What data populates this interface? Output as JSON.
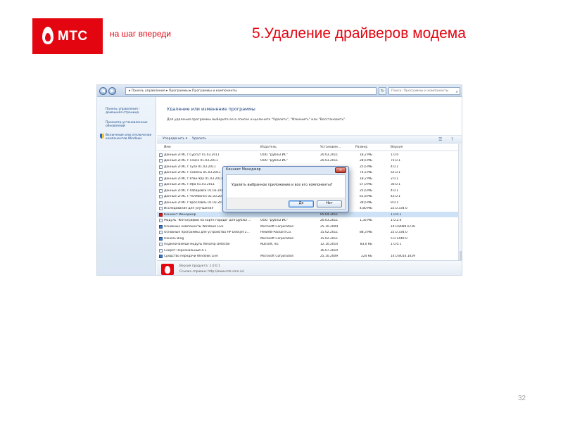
{
  "slide": {
    "logo": "МТС",
    "tagline": "на шаг впереди",
    "title": "5.Удаление драйверов модема",
    "page_number": "32"
  },
  "window": {
    "breadcrumb": "▸ Панель управления ▸ Программы ▸ Программы и компоненты",
    "search_placeholder": "Поиск: Программы и компоненты"
  },
  "sidebar": {
    "items": [
      "Панель управления - домашняя страница",
      "Просмотр установленных обновлений",
      "Включение или отключение компонентов Windows"
    ]
  },
  "main": {
    "heading": "Удаление или изменение программы",
    "subtitle": "Для удаления программы выберите ее в списке и щелкните \"Удалить\", \"Изменить\" или \"Восстановить\"."
  },
  "toolbar": {
    "organize": "Упорядочить ▾",
    "uninstall": "Удалить"
  },
  "columns": [
    "Имя",
    "Издатель",
    "Установле...",
    "Размер",
    "Версия"
  ],
  "rows": [
    {
      "name": "Данные 2ГИС г.Сургут 01.03.2011",
      "publisher": "ООО \"ДубльГИС\"",
      "date": "20.03.2011",
      "size": "18,2 МБ",
      "version": "1.0.0",
      "icon": "gray"
    },
    {
      "name": "Данные 2ГИС г.Томск 01.03.2011",
      "publisher": "ООО \"ДубльГИС\"",
      "date": "20.03.2011",
      "size": "28,6 МБ",
      "version": "75.0.1",
      "icon": "gray"
    },
    {
      "name": "Данные 2ГИС г.Тула 01.03.2011",
      "publisher": "",
      "date": "",
      "size": "25,6 МБ",
      "version": "4.0.1",
      "icon": "gray"
    },
    {
      "name": "Данные 2ГИС г.Тюмень 01.03.2011",
      "publisher": "",
      "date": "",
      "size": "74,5 МБ",
      "version": "52.0.1",
      "icon": "gray"
    },
    {
      "name": "Данные 2ГИС г.Улан-Удэ 01.03.2011",
      "publisher": "",
      "date": "",
      "size": "18,2 МБ",
      "version": "2.0.1",
      "icon": "gray"
    },
    {
      "name": "Данные 2ГИС г.Уфа 01.03.2011",
      "publisher": "",
      "date": "",
      "size": "57,0 МБ",
      "version": "36.0.1",
      "icon": "gray"
    },
    {
      "name": "Данные 2ГИС г.Хабаровск 01.03.2011",
      "publisher": "",
      "date": "",
      "size": "25,6 МБ",
      "version": "4.0.1",
      "icon": "gray"
    },
    {
      "name": "Данные 2ГИС г.Челябинск 01.03.2011",
      "publisher": "",
      "date": "",
      "size": "61,8 МБ",
      "version": "43.0.1",
      "icon": "gray"
    },
    {
      "name": "Данные 2ГИС г.Ярославль 01.03.2011",
      "publisher": "",
      "date": "",
      "size": "39,6 МБ",
      "version": "9.0.1",
      "icon": "gray"
    },
    {
      "name": "Исследование для улучшения",
      "publisher": "",
      "date": "",
      "size": "4,80 МБ",
      "version": "22.0.334.0",
      "icon": "gray"
    },
    {
      "name": "Коннект Менеджер",
      "publisher": "",
      "date": "05.04.2011",
      "size": "",
      "version": "1.0.0.1",
      "icon": "red",
      "selected": true
    },
    {
      "name": "Модуль \"Фотографии на карте города\" для ДубльГ...",
      "publisher": "ООО \"ДубльГИС\"",
      "date": "20.03.2011",
      "size": "1,35 МБ",
      "version": "1.0.2.0",
      "icon": "gray"
    },
    {
      "name": "Основные компоненты Windows Live",
      "publisher": "Microsoft Corporation",
      "date": "25.10.2009",
      "size": "",
      "version": "14.0.8089.0726",
      "icon": "blue"
    },
    {
      "name": "Основные программы для устройства HP Deskjet 2...",
      "publisher": "Hewlett-Packard Co.",
      "date": "15.02.2011",
      "size": "88,3 МБ",
      "version": "22.0.334.0",
      "icon": "gray"
    },
    {
      "name": "Панель Bing",
      "publisher": "Microsoft Corporation",
      "date": "15.02.2011",
      "size": "",
      "version": "5.0.1449.0",
      "icon": "blue"
    },
    {
      "name": "Подключаемый модуль Winamp Detector",
      "publisher": "Nullsoft, Inc",
      "date": "12.10.2010",
      "size": "83,0 КБ",
      "version": "1.0.0.1",
      "icon": "gray"
    },
    {
      "name": "Секрет Персональный 4.1",
      "publisher": "",
      "date": "16.07.2010",
      "size": "",
      "version": "",
      "icon": "gray"
    },
    {
      "name": "Средство передачи Windows Live",
      "publisher": "Microsoft Corporation",
      "date": "25.10.2009",
      "size": "224 КБ",
      "version": "14.0.8014.1029",
      "icon": "blue"
    }
  ],
  "details": {
    "version_line": "Версия продукта: 1.0.0.1",
    "help_line": "Ссылка справки: http://www.mts.com.ru/"
  },
  "dialog": {
    "title": "Коннект Менеджер",
    "message": "Удалить выбранное приложение и все его компоненты?",
    "yes": "Да",
    "no": "Нет"
  }
}
